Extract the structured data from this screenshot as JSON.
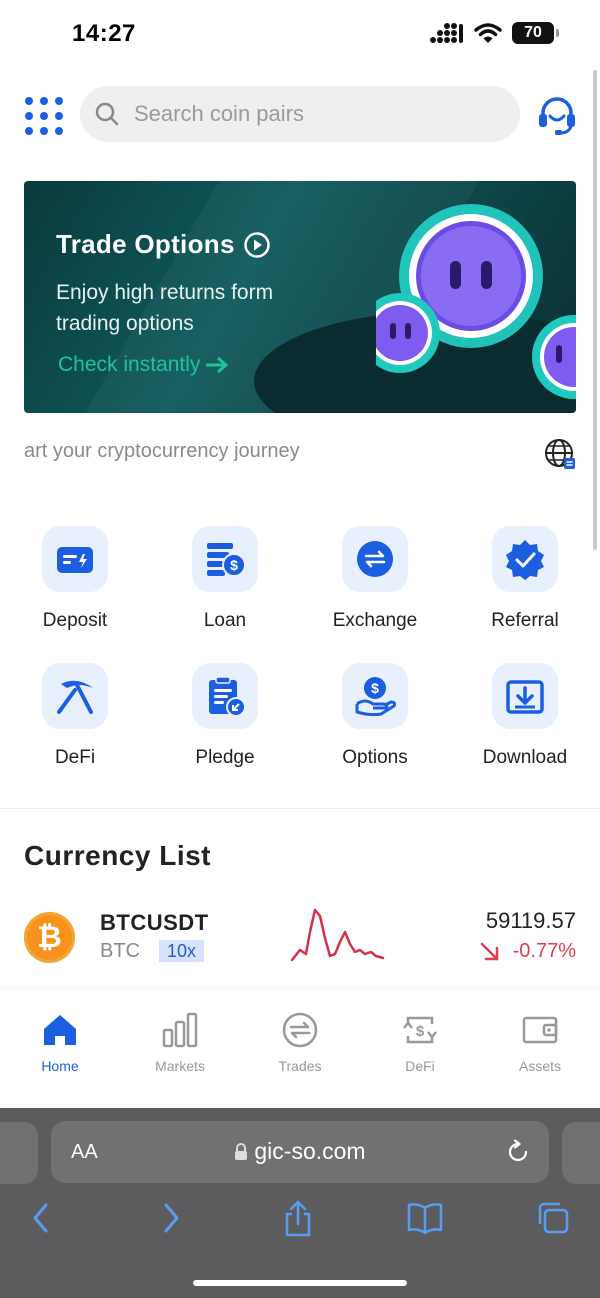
{
  "status": {
    "time": "14:27",
    "battery": "70"
  },
  "header": {
    "search_placeholder": "Search coin pairs"
  },
  "banner": {
    "title": "Trade Options",
    "subtitle": "Enjoy high returns form trading options",
    "cta": "Check instantly"
  },
  "marquee": "art your cryptocurrency journey",
  "menu": [
    {
      "label": "Deposit",
      "icon": "deposit-icon"
    },
    {
      "label": "Loan",
      "icon": "loan-icon"
    },
    {
      "label": "Exchange",
      "icon": "exchange-icon"
    },
    {
      "label": "Referral",
      "icon": "referral-icon"
    },
    {
      "label": "DeFi",
      "icon": "pickaxe-icon"
    },
    {
      "label": "Pledge",
      "icon": "pledge-icon"
    },
    {
      "label": "Options",
      "icon": "options-icon"
    },
    {
      "label": "Download",
      "icon": "download-icon"
    }
  ],
  "currency_list": {
    "title": "Currency List",
    "rows": [
      {
        "pair": "BTCUSDT",
        "base": "BTC",
        "leverage": "10x",
        "price": "59119.57",
        "change": "-0.77%",
        "logo": "₿"
      }
    ]
  },
  "tabs": [
    {
      "label": "Home",
      "active": true
    },
    {
      "label": "Markets",
      "active": false
    },
    {
      "label": "Trades",
      "active": false
    },
    {
      "label": "DeFi",
      "active": false
    },
    {
      "label": "Assets",
      "active": false
    }
  ],
  "browser": {
    "aa": "AA",
    "url": "gic-so.com"
  },
  "colors": {
    "accent": "#1b5fe0",
    "negative": "#e03c53",
    "banner_cta": "#1fc39a",
    "tile_bg": "#e8f0fd"
  }
}
